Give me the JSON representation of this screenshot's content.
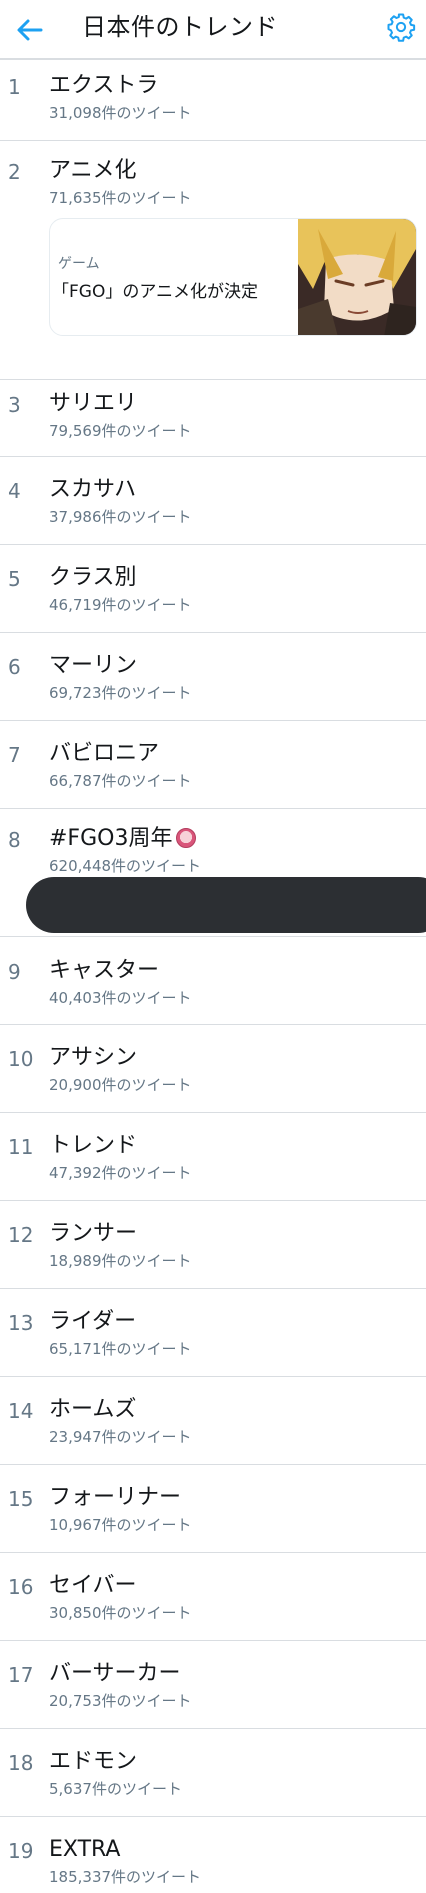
{
  "header": {
    "title": "日本件のトレンド",
    "back_icon": "arrow-left-icon",
    "settings_icon": "gear-icon",
    "accent_color": "#1da1f2"
  },
  "trends": [
    {
      "rank": "1",
      "name": "エクストラ",
      "count": "31,098件のツイート"
    },
    {
      "rank": "2",
      "name": "アニメ化",
      "count": "71,635件のツイート",
      "card": {
        "category": "ゲーム",
        "title": "「FGO」のアニメ化が決定",
        "thumbnail": "anime-character-thumbnail"
      }
    },
    {
      "rank": "3",
      "name": "サリエリ",
      "count": "79,569件のツイート"
    },
    {
      "rank": "4",
      "name": "スカサハ",
      "count": "37,986件のツイート"
    },
    {
      "rank": "5",
      "name": "クラス別",
      "count": "46,719件のツイート"
    },
    {
      "rank": "6",
      "name": "マーリン",
      "count": "69,723件のツイート"
    },
    {
      "rank": "7",
      "name": "バビロニア",
      "count": "66,787件のツイート"
    },
    {
      "rank": "8",
      "name": "#FGO3周年",
      "count": "620,448件のツイート",
      "emoji": "character-avatar-emoji",
      "redacted": true
    },
    {
      "rank": "9",
      "name": "キャスター",
      "count": "40,403件のツイート"
    },
    {
      "rank": "10",
      "name": "アサシン",
      "count": "20,900件のツイート"
    },
    {
      "rank": "11",
      "name": "トレンド",
      "count": "47,392件のツイート"
    },
    {
      "rank": "12",
      "name": "ランサー",
      "count": "18,989件のツイート"
    },
    {
      "rank": "13",
      "name": "ライダー",
      "count": "65,171件のツイート"
    },
    {
      "rank": "14",
      "name": "ホームズ",
      "count": "23,947件のツイート"
    },
    {
      "rank": "15",
      "name": "フォーリナー",
      "count": "10,967件のツイート"
    },
    {
      "rank": "16",
      "name": "セイバー",
      "count": "30,850件のツイート"
    },
    {
      "rank": "17",
      "name": "バーサーカー",
      "count": "20,753件のツイート"
    },
    {
      "rank": "18",
      "name": "エドモン",
      "count": "5,637件のツイート"
    },
    {
      "rank": "19",
      "name": "EXTRA",
      "count": "185,337件のツイート"
    }
  ]
}
